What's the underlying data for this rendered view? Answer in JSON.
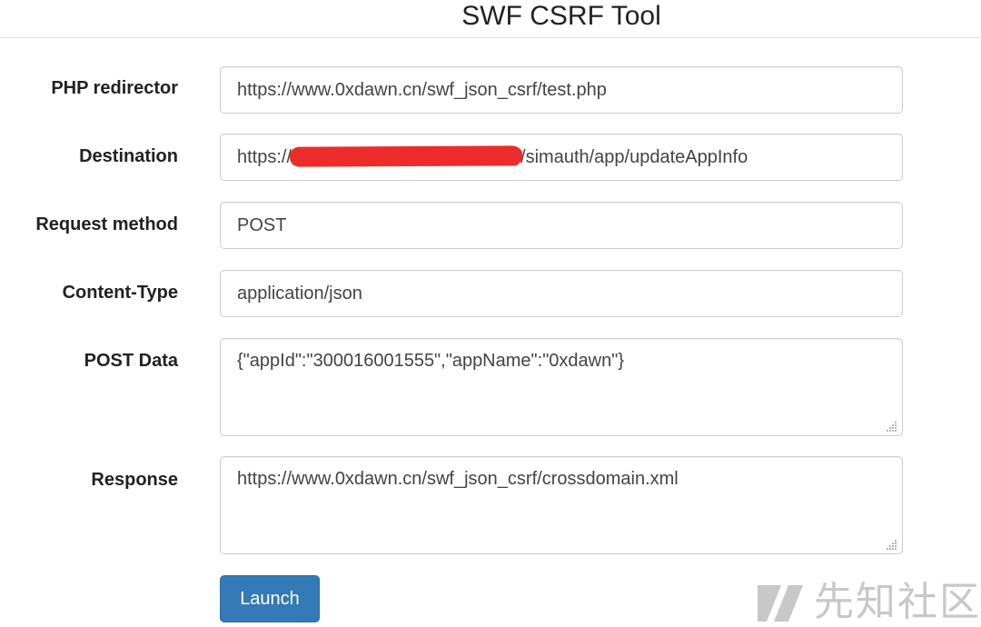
{
  "page": {
    "title": "SWF CSRF Tool"
  },
  "form": {
    "php_redirector": {
      "label": "PHP redirector",
      "value": "https://www.0xdawn.cn/swf_json_csrf/test.php"
    },
    "destination": {
      "label": "Destination",
      "value_prefix": "https://",
      "value_suffix": "/simauth/app/updateAppInfo"
    },
    "request_method": {
      "label": "Request method",
      "value": "POST"
    },
    "content_type": {
      "label": "Content-Type",
      "value": "application/json"
    },
    "post_data": {
      "label": "POST Data",
      "value": "{\"appId\":\"300016001555\",\"appName\":\"0xdawn\"}"
    },
    "response": {
      "label": "Response",
      "value": "https://www.0xdawn.cn/swf_json_csrf/crossdomain.xml"
    },
    "launch_label": "Launch"
  },
  "watermark": {
    "text": "先知社区"
  },
  "colors": {
    "button": "#337ab7",
    "redaction": "#ee2b2b",
    "border": "#cccccc"
  },
  "icons": {
    "resize": "resize-grip-icon",
    "logo": "xianzhi-logo-icon"
  }
}
